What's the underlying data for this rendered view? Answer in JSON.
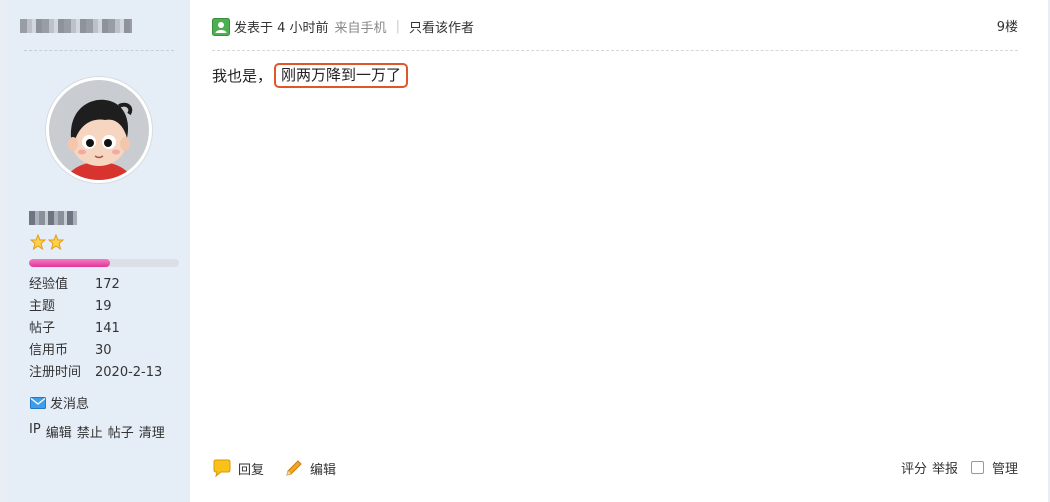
{
  "sidebar": {
    "stats": [
      {
        "label": "经验值",
        "value": "172"
      },
      {
        "label": "主题",
        "value": "19"
      },
      {
        "label": "帖子",
        "value": "141"
      },
      {
        "label": "信用币",
        "value": "30"
      },
      {
        "label": "注册时间",
        "value": "2020-2-13"
      }
    ],
    "level_progress": 0.54,
    "message_label": "发消息",
    "admin_links": [
      "IP",
      "编辑",
      "禁止",
      "帖子",
      "清理"
    ]
  },
  "post": {
    "posted_label": "发表于 4 小时前",
    "from_label": "来自手机",
    "author_only_label": "只看该作者",
    "floor": "9楼",
    "content_plain": "我也是，",
    "content_highlight": "刚两万降到一万了"
  },
  "actions": {
    "reply_label": "回复",
    "edit_label": "编辑",
    "rate_label": "评分",
    "report_label": "举报",
    "manage_label": "管理"
  },
  "colors": {
    "sidebar_bg": "#e5edf7",
    "highlight_border": "#e0562b",
    "progress_pink": "#e2369a"
  }
}
